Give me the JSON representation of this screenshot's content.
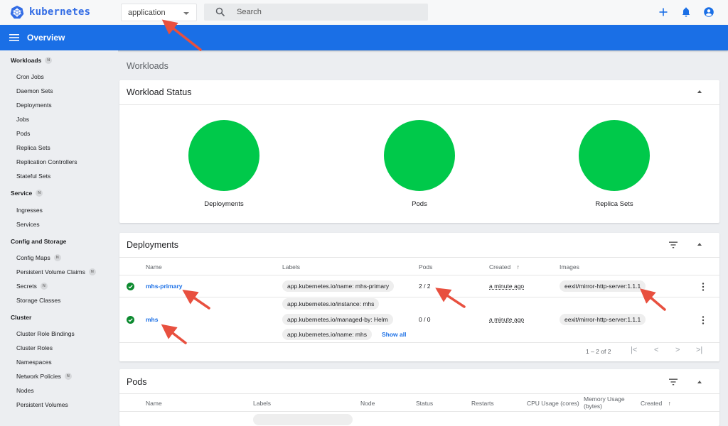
{
  "app": {
    "logo_text": "kubernetes",
    "namespace_selected": "application",
    "search_placeholder": "Search",
    "brand_color": "#326ce5",
    "toolbar_color": "#1a6fe6"
  },
  "toolbar": {
    "title": "Overview"
  },
  "sidebar": {
    "sections": [
      {
        "label": "Workloads",
        "badge": "N",
        "items": [
          {
            "label": "Cron Jobs"
          },
          {
            "label": "Daemon Sets"
          },
          {
            "label": "Deployments"
          },
          {
            "label": "Jobs"
          },
          {
            "label": "Pods"
          },
          {
            "label": "Replica Sets"
          },
          {
            "label": "Replication Controllers"
          },
          {
            "label": "Stateful Sets"
          }
        ]
      },
      {
        "label": "Service",
        "badge": "N",
        "items": [
          {
            "label": "Ingresses"
          },
          {
            "label": "Services"
          }
        ]
      },
      {
        "label": "Config and Storage",
        "items": [
          {
            "label": "Config Maps",
            "badge": "N"
          },
          {
            "label": "Persistent Volume Claims",
            "badge": "N"
          },
          {
            "label": "Secrets",
            "badge": "N"
          },
          {
            "label": "Storage Classes"
          }
        ]
      },
      {
        "label": "Cluster",
        "items": [
          {
            "label": "Cluster Role Bindings"
          },
          {
            "label": "Cluster Roles"
          },
          {
            "label": "Namespaces"
          },
          {
            "label": "Network Policies",
            "badge": "N"
          },
          {
            "label": "Nodes"
          },
          {
            "label": "Persistent Volumes"
          }
        ]
      }
    ]
  },
  "main": {
    "page_title": "Workloads",
    "workload_status": {
      "title": "Workload Status",
      "status_color": "#00c94a",
      "items": [
        {
          "label": "Deployments",
          "running_fraction": 1.0
        },
        {
          "label": "Pods",
          "running_fraction": 1.0
        },
        {
          "label": "Replica Sets",
          "running_fraction": 1.0
        }
      ]
    },
    "deployments": {
      "title": "Deployments",
      "columns": {
        "name": "Name",
        "labels": "Labels",
        "pods": "Pods",
        "created": "Created",
        "images": "Images"
      },
      "rows": [
        {
          "status": "running",
          "name": "mhs-primary",
          "labels": [
            "app.kubernetes.io/name: mhs-primary"
          ],
          "pods": "2 / 2",
          "created": "a minute ago",
          "images": [
            "eexit/mirror-http-server:1.1.1"
          ]
        },
        {
          "status": "running",
          "name": "mhs",
          "labels": [
            "app.kubernetes.io/instance: mhs",
            "app.kubernetes.io/managed-by: Helm",
            "app.kubernetes.io/name: mhs"
          ],
          "show_all": "Show all",
          "pods": "0 / 0",
          "created": "a minute ago",
          "images": [
            "eexit/mirror-http-server:1.1.1"
          ]
        }
      ],
      "pagination": "1 – 2 of 2"
    },
    "pods": {
      "title": "Pods",
      "columns": {
        "name": "Name",
        "labels": "Labels",
        "node": "Node",
        "status": "Status",
        "restarts": "Restarts",
        "cpu": "CPU Usage (cores)",
        "memory_1": "Memory Usage",
        "memory_2": "(bytes)",
        "created": "Created"
      }
    }
  }
}
